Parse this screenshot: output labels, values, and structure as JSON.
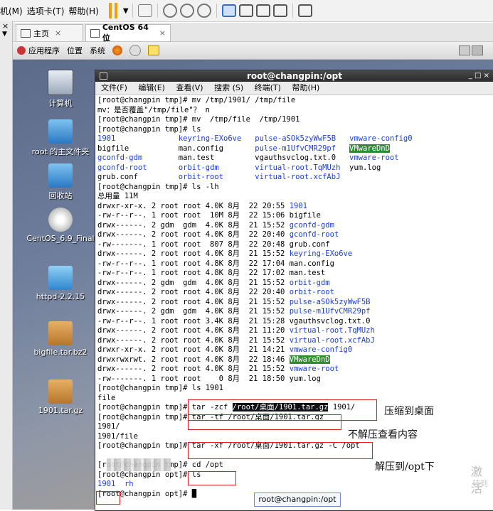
{
  "menubar": {
    "items": [
      "机(M)",
      "选项卡(T)",
      "帮助(H)"
    ]
  },
  "tabs": [
    {
      "label": "主页",
      "close": "×"
    },
    {
      "label": "CentOS 64 位",
      "close": "×"
    }
  ],
  "panel": {
    "items": [
      "应用程序",
      "位置",
      "系统"
    ]
  },
  "desktop_icons": [
    "计算机",
    "root 的主文件夹",
    "回收站",
    "CentOS_6.9_Final",
    "httpd-2.2.15",
    "bigfile.tar.bz2",
    "1901.tar.gz"
  ],
  "terminal": {
    "title": "root@changpin:/opt",
    "controls": "_ □ ×",
    "menu": [
      "文件(F)",
      "编辑(E)",
      "查看(V)",
      "搜索 (S)",
      "终端(T)",
      "帮助(H)"
    ]
  },
  "annotations": {
    "a1": "压缩到桌面",
    "a2": "不解压查看内容",
    "a3": "解压到/opt下"
  },
  "tooltip": "root@changpin:/opt",
  "watermark": {
    "line1": "激活",
    "line2": "转到"
  }
}
